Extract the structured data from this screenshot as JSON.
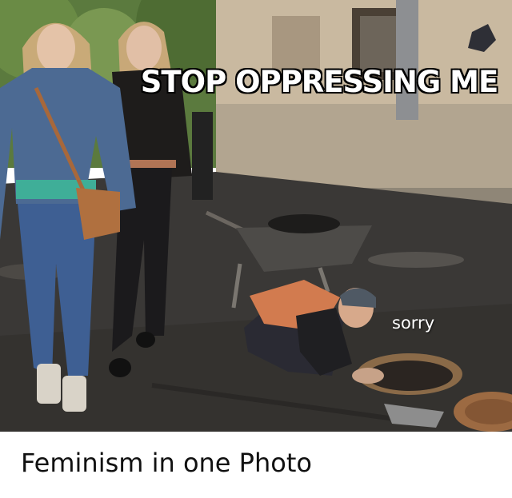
{
  "meme": {
    "top_text": "STOP OPPRESSING ME",
    "overlay_text": "sorry",
    "caption": "Feminism in one Photo"
  },
  "colors": {
    "asphalt": "#3a3836",
    "building": "#c9b9a0",
    "denim": "#4c6a93",
    "leather": "#1e1c1b",
    "vest": "#d27b4f"
  }
}
